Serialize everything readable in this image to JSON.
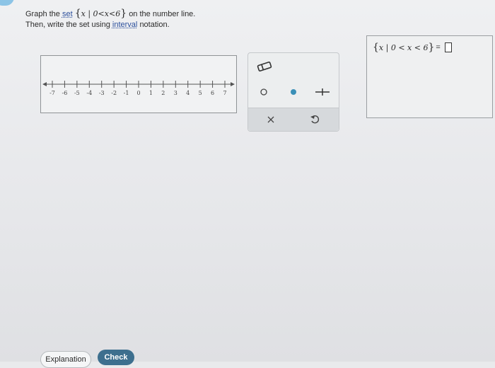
{
  "question": {
    "line1_pre": "Graph the",
    "set_link": "set",
    "set_expr": "x | 0<x<6",
    "line1_post": "on the number line.",
    "line2_pre": "Then, write the set using",
    "interval_link": "interval",
    "line2_post": "notation."
  },
  "number_line": {
    "min": -7,
    "max": 7,
    "ticks": [
      "-7",
      "-6",
      "-5",
      "-4",
      "-3",
      "-2",
      "-1",
      "0",
      "1",
      "2",
      "3",
      "4",
      "5",
      "6",
      "7"
    ]
  },
  "tools": {
    "eraser_icon": "eraser-icon",
    "open_circle_icon": "open-circle-icon",
    "closed_circle_icon": "closed-circle-icon",
    "segment_icon": "segment-icon",
    "clear_icon": "x-icon",
    "undo_icon": "undo-icon",
    "closed_circle_color": "#3a8fb7"
  },
  "answer": {
    "expr": "x | 0 < x < 6",
    "equals": "="
  },
  "buttons": {
    "explanation": "Explanation",
    "check": "Check"
  }
}
